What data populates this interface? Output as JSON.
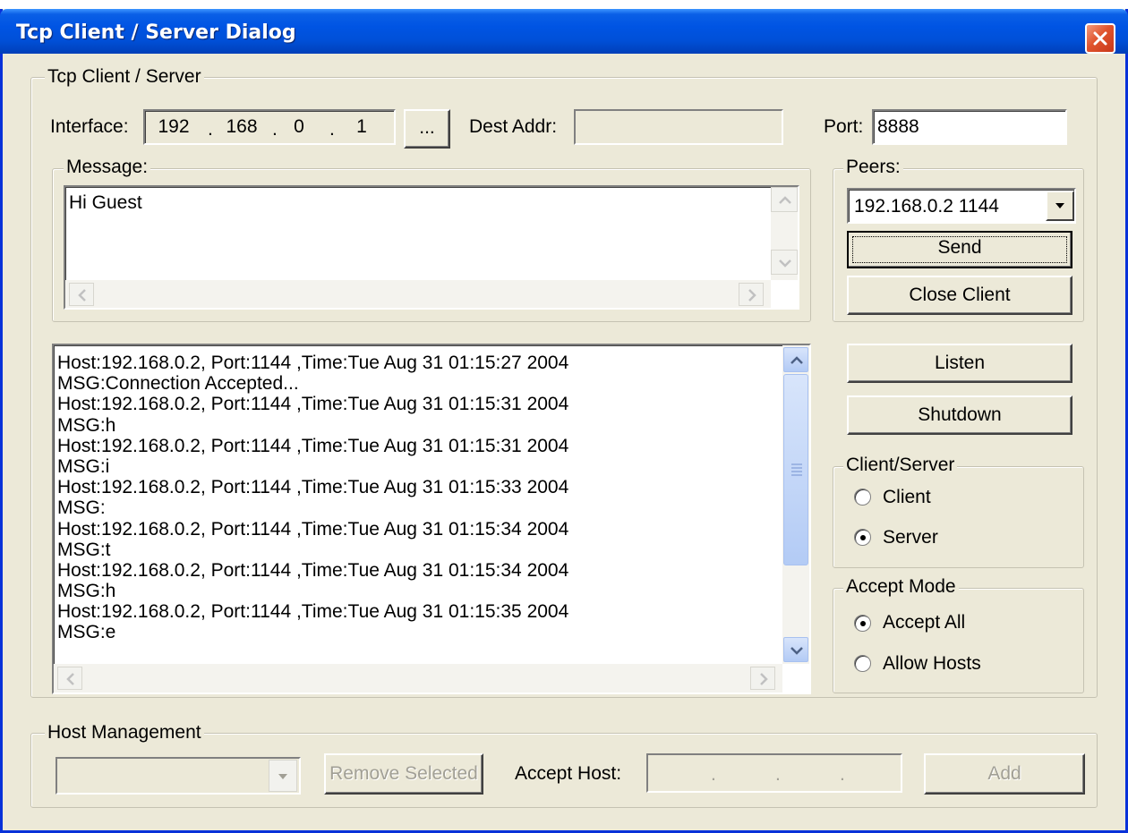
{
  "window": {
    "title": "Tcp Client / Server Dialog"
  },
  "tcp_group": {
    "legend": "Tcp Client / Server",
    "interface_label": "Interface:",
    "interface_ip": [
      "192",
      "168",
      "0",
      "1"
    ],
    "browse_label": "...",
    "dest_addr_label": "Dest Addr:",
    "dest_addr_value": "",
    "port_label": "Port:",
    "port_value": "8888"
  },
  "message_group": {
    "legend": "Message:",
    "text": "Hi Guest"
  },
  "peers_group": {
    "legend": "Peers:",
    "selected_peer": "192.168.0.2 1144",
    "send_label": "Send",
    "close_client_label": "Close Client"
  },
  "log": {
    "lines": [
      "Host:192.168.0.2, Port:1144 ,Time:Tue Aug 31 01:15:27 2004",
      "MSG:Connection Accepted...",
      "Host:192.168.0.2, Port:1144 ,Time:Tue Aug 31 01:15:31 2004",
      "MSG:h",
      "Host:192.168.0.2, Port:1144 ,Time:Tue Aug 31 01:15:31 2004",
      "MSG:i",
      "Host:192.168.0.2, Port:1144 ,Time:Tue Aug 31 01:15:33 2004",
      "MSG:",
      "Host:192.168.0.2, Port:1144 ,Time:Tue Aug 31 01:15:34 2004",
      "MSG:t",
      "Host:192.168.0.2, Port:1144 ,Time:Tue Aug 31 01:15:34 2004",
      "MSG:h",
      "Host:192.168.0.2, Port:1144 ,Time:Tue Aug 31 01:15:35 2004",
      "MSG:e"
    ]
  },
  "buttons": {
    "listen_label": "Listen",
    "shutdown_label": "Shutdown"
  },
  "client_server_group": {
    "legend": "Client/Server",
    "client_label": "Client",
    "server_label": "Server",
    "selected": "Server"
  },
  "accept_mode_group": {
    "legend": "Accept Mode",
    "accept_all_label": "Accept All",
    "allow_hosts_label": "Allow Hosts",
    "selected": "Accept All"
  },
  "host_management": {
    "legend": "Host Management",
    "host_select_value": "",
    "remove_selected_label": "Remove Selected",
    "accept_host_label": "Accept Host:",
    "accept_host_ip_dots": [
      ".",
      ".",
      "."
    ],
    "add_label": "Add"
  },
  "colors": {
    "title_bar": "#0054e3",
    "dialog_face": "#ece9d8",
    "close_button": "#e0542d",
    "disabled_text": "#a19f95"
  }
}
